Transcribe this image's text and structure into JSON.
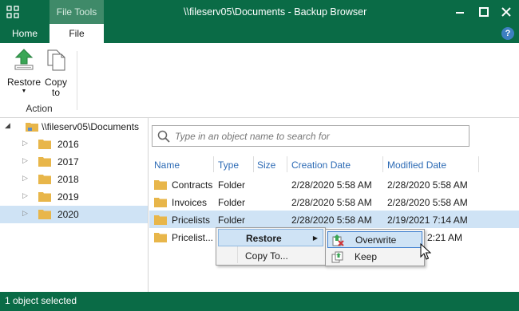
{
  "window": {
    "title": "\\\\fileserv05\\Documents - Backup Browser",
    "tools_tab": "File Tools",
    "buttons": [
      "minimize-icon",
      "maximize-icon",
      "close-icon"
    ]
  },
  "ribbon": {
    "tabs": [
      {
        "label": "Home",
        "active": false
      },
      {
        "label": "File",
        "active": true
      }
    ],
    "buttons": [
      {
        "label": "Restore",
        "icon": "restore-icon",
        "has_dropdown": true
      },
      {
        "label": "Copy to",
        "icon": "copy-icon"
      }
    ],
    "group_label": "Action"
  },
  "tree": {
    "root": "\\\\fileserv05\\Documents",
    "items": [
      {
        "label": "2016",
        "selected": false
      },
      {
        "label": "2017",
        "selected": false
      },
      {
        "label": "2018",
        "selected": false
      },
      {
        "label": "2019",
        "selected": false
      },
      {
        "label": "2020",
        "selected": true
      }
    ]
  },
  "search": {
    "placeholder": "Type in an object name to search for",
    "value": ""
  },
  "table": {
    "columns": [
      "Name",
      "Type",
      "Size",
      "Creation Date",
      "Modified Date"
    ],
    "rows": [
      {
        "name": "Contracts",
        "type": "Folder",
        "size": "",
        "created": "2/28/2020 5:58 AM",
        "modified": "2/28/2020 5:58 AM",
        "selected": false
      },
      {
        "name": "Invoices",
        "type": "Folder",
        "size": "",
        "created": "2/28/2020 5:58 AM",
        "modified": "2/28/2020 5:58 AM",
        "selected": false
      },
      {
        "name": "Pricelists",
        "type": "Folder",
        "size": "",
        "created": "2/28/2020 5:58 AM",
        "modified": "2/19/2021 7:14 AM",
        "selected": true
      },
      {
        "name": "Pricelist...",
        "type": "",
        "size": "",
        "created": "",
        "modified": "2:21 AM",
        "selected": false
      }
    ]
  },
  "context_menu": {
    "items": [
      {
        "label": "Restore",
        "has_submenu": true,
        "highlighted": true
      },
      {
        "label": "Copy To...",
        "has_submenu": false,
        "highlighted": false
      }
    ],
    "submenu": [
      {
        "label": "Overwrite",
        "icon": "overwrite-icon",
        "highlighted": true
      },
      {
        "label": "Keep",
        "icon": "keep-icon",
        "highlighted": false
      }
    ]
  },
  "status": {
    "text": "1 object selected"
  },
  "colors": {
    "brand": "#0a6b46",
    "selection": "#cfe3f5",
    "header_text": "#2d6bb5",
    "folder": "#e8b64a"
  }
}
